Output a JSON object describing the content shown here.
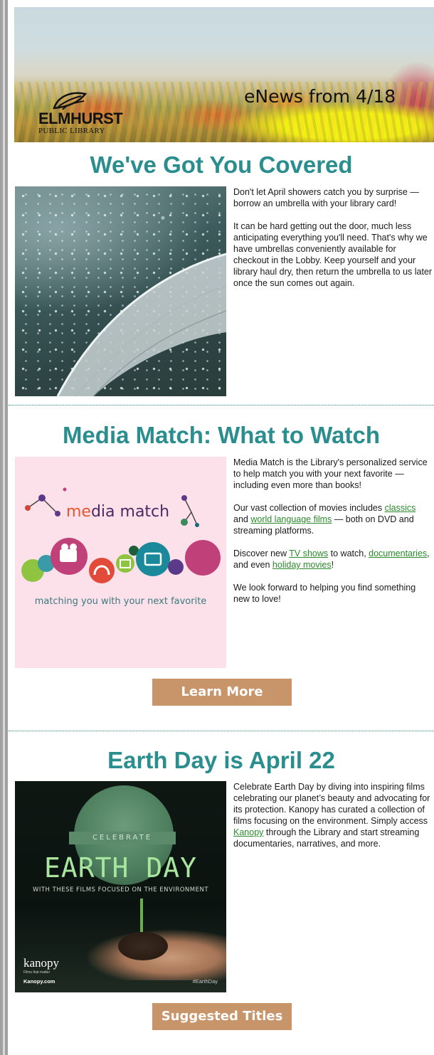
{
  "header": {
    "enews_label": "eNews from 4/18",
    "logo_name": "ELMHURST",
    "logo_sub": "PUBLIC LIBRARY"
  },
  "sections": [
    {
      "title": "We've Got You Covered",
      "paragraphs": [
        "Don't let April showers catch you by surprise — borrow an umbrella with your library card!",
        "It can be hard getting out the door, much less anticipating everything you'll need. That's why we have umbrellas conveniently available for checkout in the Lobby. Keep yourself and your library haul dry, then return the umbrella to us later once the sun comes out again."
      ]
    },
    {
      "title": "Media Match: What to Watch",
      "image_title_accent": "me",
      "image_title_rest": "dia match",
      "image_caption": "matching you with your next favorite",
      "p1": "Media Match is the Library's personalized service to help match you with your next favorite — including even more than books!",
      "p2_pre": "Our vast collection of movies includes ",
      "p2_link1": "classics",
      "p2_mid": " and ",
      "p2_link2": "world language films",
      "p2_post": " — both on DVD and streaming platforms.",
      "p3_pre": "Discover new ",
      "p3_link1": "TV shows",
      "p3_mid1": " to watch, ",
      "p3_link2": "documentaries",
      "p3_mid2": ", and even ",
      "p3_link3": "holiday movies",
      "p3_post": "!",
      "p4": "We look forward to helping you find something new to love!",
      "button": "Learn More"
    },
    {
      "title": "Earth Day is April 22",
      "ribbon": "CELEBRATE",
      "image_title": "EARTH DAY",
      "image_sub": "WITH THESE FILMS FOCUSED ON THE ENVIRONMENT",
      "kanopy_logo": "kanopy",
      "kanopy_tagline": "Films that matter",
      "kanopy_url": "Kanopy.com",
      "hashtag": "#EarthDay",
      "p1_pre": "Celebrate Earth Day by diving into inspiring films celebrating our planet’s beauty and advocating for its protection. Kanopy has curated a collection of films focusing on the environment. Simply access ",
      "p1_link": "Kanopy",
      "p1_post": " through the Library and start streaming documentaries, narratives, and more.",
      "button": "Suggested Titles"
    }
  ],
  "colors": {
    "heading": "#2a8d8e",
    "link": "#2a8a2a",
    "button": "#c8956a",
    "highlight": "#f2ef12"
  }
}
